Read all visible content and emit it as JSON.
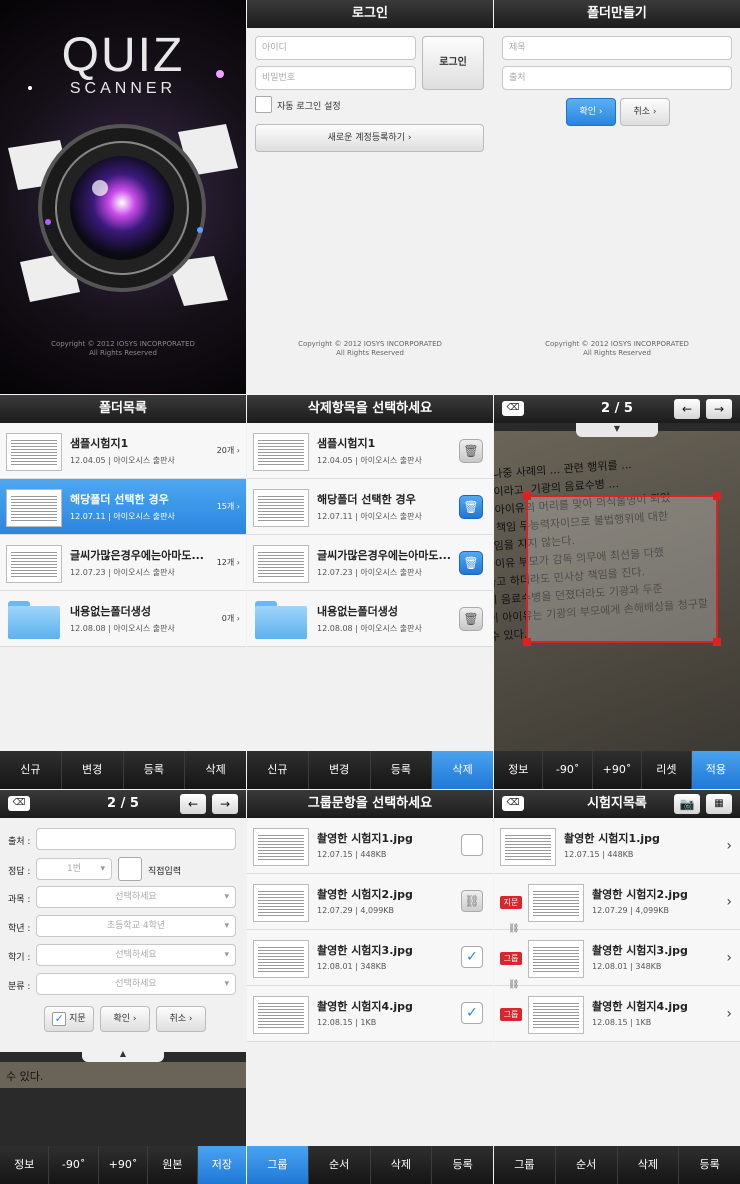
{
  "splash": {
    "logo_line1": "QUIZ",
    "logo_line2": "SCANNER",
    "copyright1": "Copyright © 2012 IOSYS INCORPORATED",
    "copyright2": "All Rights Reserved"
  },
  "login": {
    "title": "로그인",
    "id_placeholder": "아이디",
    "pw_placeholder": "비밀번호",
    "login_button": "로그인",
    "auto_login": "자동 로그인 설정",
    "register_button": "새로운 계정등록하기 ›",
    "copyright1": "Copyright © 2012 IOSYS INCORPORATED",
    "copyright2": "All Rights Reserved"
  },
  "make_folder": {
    "title": "폴더만들기",
    "name_placeholder": "제목",
    "source_placeholder": "출처",
    "ok_button": "확인 ›",
    "cancel_button": "취소 ›",
    "copyright1": "Copyright © 2012 IOSYS INCORPORATED",
    "copyright2": "All Rights Reserved"
  },
  "folder_list": {
    "title": "폴더목록",
    "items": [
      {
        "title": "샘플시험지1",
        "sub": "12.04.05 | 아이오시스 출판사",
        "count": "20개"
      },
      {
        "title": "해당폴더 선택한 경우",
        "sub": "12.07.11 | 아이오시스 출판사",
        "count": "15개"
      },
      {
        "title": "글씨가많은경우에는아마도...",
        "sub": "12.07.23 | 아이오시스 출판사",
        "count": "12개"
      },
      {
        "title": "내용없는폴더생성",
        "sub": "12.08.08 | 아이오시스 출판사",
        "count": "0개"
      }
    ],
    "tabs": [
      "신규",
      "변경",
      "등록",
      "삭제"
    ]
  },
  "delete_select": {
    "title": "삭제항목을 선택하세요",
    "items": [
      {
        "title": "샘플시험지1",
        "sub": "12.04.05 | 아이오시스 출판사"
      },
      {
        "title": "해당폴더 선택한 경우",
        "sub": "12.07.11 | 아이오시스 출판사"
      },
      {
        "title": "글씨가많은경우에는아마도...",
        "sub": "12.07.23 | 아이오시스 출판사"
      },
      {
        "title": "내용없는폴더생성",
        "sub": "12.08.08 | 아이오시스 출판사"
      }
    ],
    "tabs": [
      "신규",
      "변경",
      "등록",
      "삭제"
    ]
  },
  "crop": {
    "page": "2 / 5",
    "doc_lines": [
      "는 나중 사례의 ... 관련 행위를 ...",
      "했 이라고, 기광의 음료수병 ...",
      "나 아이유의 머리를 맞아 의식불명이 되었",
      "은 책임 무능력자이므로 불법행위에 대한",
      "책임을 지지 않는다.",
      "아이유 부모가 감독 의무에 최선을 다했",
      "다고 하더라도 민사상 책임을 진다.",
      "이 음료수병을 던졌더라도 기광과 두준",
      "이 아이유는 기광의 부모에게 손해배상을 청구할",
      "수 있다."
    ],
    "tabs": [
      "정보",
      "-90˚",
      "+90˚",
      "리셋",
      "적용"
    ]
  },
  "info_form": {
    "page": "2 / 5",
    "source_label": "출처 :",
    "answer_label": "정답 :",
    "answer_value": "1번",
    "direct_input": "직접입력",
    "subject_label": "과목 :",
    "subject_value": "선택하세요",
    "grade_label": "학년 :",
    "grade_value": "초등학교 4학년",
    "term_label": "학기 :",
    "term_value": "선택하세요",
    "category_label": "분류 :",
    "category_value": "선택하세요",
    "passage": "지문",
    "ok_button": "확인 ›",
    "cancel_button": "취소 ›",
    "bg_text": "수 있다.",
    "tabs": [
      "정보",
      "-90˚",
      "+90˚",
      "원본",
      "저장"
    ]
  },
  "group_select": {
    "title": "그룹문항을 선택하세요",
    "items": [
      {
        "title": "촬영한 시험지1.jpg",
        "sub": "12.07.15 | 448KB"
      },
      {
        "title": "촬영한 시험지2.jpg",
        "sub": "12.07.29 | 4,099KB"
      },
      {
        "title": "촬영한 시험지3.jpg",
        "sub": "12.08.01 | 348KB"
      },
      {
        "title": "촬영한 시험지4.jpg",
        "sub": "12.08.15 | 1KB"
      }
    ],
    "tabs": [
      "그룹",
      "순서",
      "삭제",
      "등록"
    ]
  },
  "exam_list": {
    "title": "시험지목록",
    "tags": [
      "지문",
      "그룹",
      "그룹"
    ],
    "items": [
      {
        "title": "촬영한 시험지1.jpg",
        "sub": "12.07.15 | 448KB"
      },
      {
        "title": "촬영한 시험지2.jpg",
        "sub": "12.07.29 | 4,099KB"
      },
      {
        "title": "촬영한 시험지3.jpg",
        "sub": "12.08.01 | 348KB"
      },
      {
        "title": "촬영한 시험지4.jpg",
        "sub": "12.08.15 | 1KB"
      }
    ],
    "tabs": [
      "그룹",
      "순서",
      "삭제",
      "등록"
    ]
  }
}
